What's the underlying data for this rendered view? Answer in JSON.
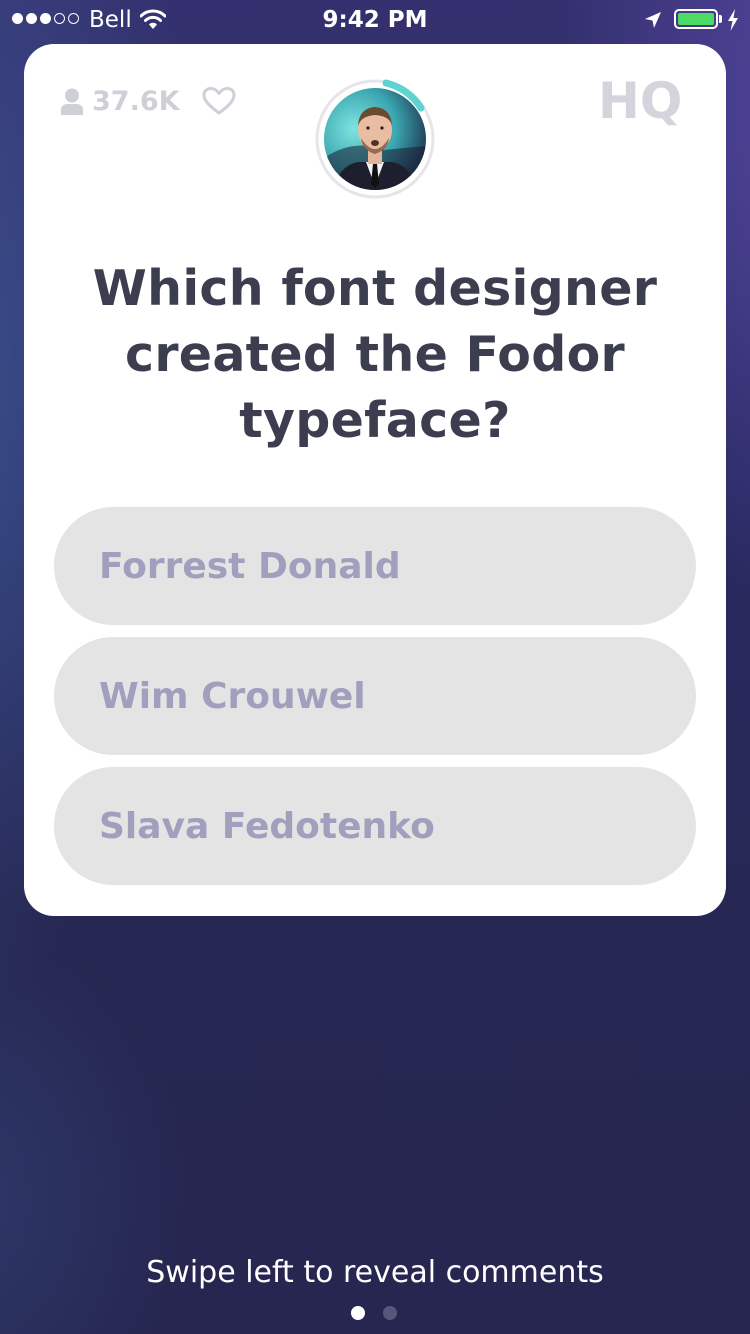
{
  "status_bar": {
    "carrier": "Bell",
    "time": "9:42 PM",
    "signal_bars_total": 5,
    "signal_bars_filled": 3,
    "battery_level": 1.0,
    "battery_color": "#4cd964",
    "icons": [
      "wifi-icon",
      "location-arrow-icon",
      "battery-icon",
      "charging-bolt-icon"
    ]
  },
  "game": {
    "viewer_count": "37.6K",
    "viewer_icon": "person-icon",
    "like_icon": "heart-icon",
    "logo_text": "HQ",
    "host_avatar": "host-avatar",
    "timer_color": "#5fd3d0",
    "question": "Which font designer created the Fodor typeface?",
    "answers": [
      {
        "label": "Forrest Donald"
      },
      {
        "label": "Wim Crouwel"
      },
      {
        "label": "Slava Fedotenko"
      }
    ]
  },
  "footer": {
    "hint": "Swipe left to reveal comments",
    "page_count": 2,
    "active_page": 1
  },
  "colors": {
    "card": "#ffffff",
    "question_text": "#3c3e4f",
    "answer_bg": "#e4e4e4",
    "answer_text": "#a09fbd",
    "muted_icon": "#cfcfd8"
  }
}
